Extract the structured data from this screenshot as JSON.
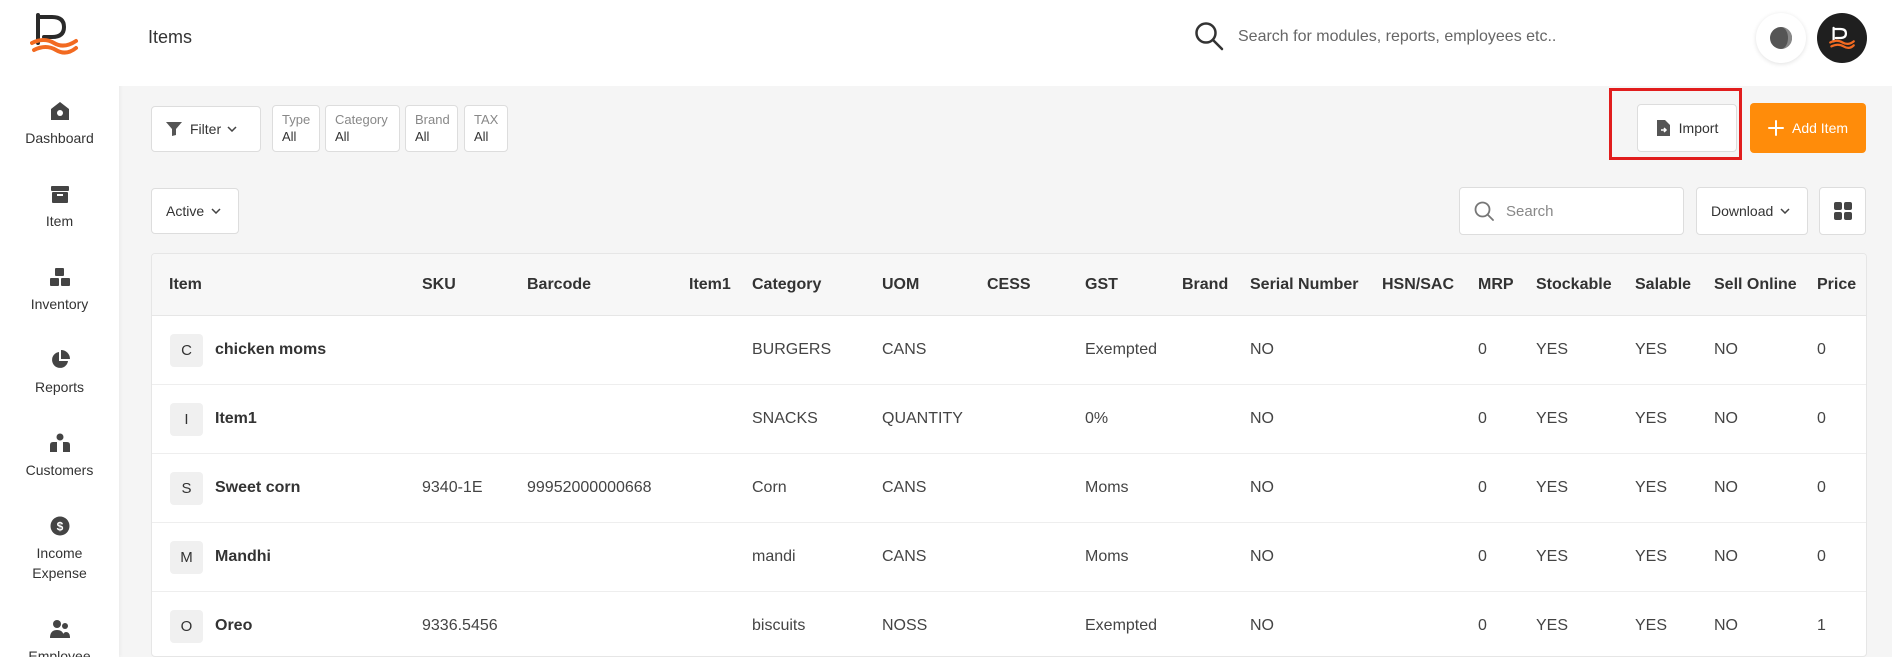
{
  "header": {
    "title": "Items",
    "search_placeholder": "Search for modules, reports, employees etc.."
  },
  "sidebar": {
    "items": [
      {
        "label": "Dashboard",
        "icon": "home-icon"
      },
      {
        "label": "Item",
        "icon": "box-icon"
      },
      {
        "label": "Inventory",
        "icon": "boxes-icon"
      },
      {
        "label": "Reports",
        "icon": "pie-chart-icon"
      },
      {
        "label": "Customers",
        "icon": "users-icon"
      },
      {
        "label": "Income\nExpense",
        "icon": "dollar-icon"
      },
      {
        "label": "Employee",
        "icon": "employee-icon"
      }
    ]
  },
  "toolbar": {
    "filter_label": "Filter",
    "chips": [
      {
        "label": "Type",
        "value": "All"
      },
      {
        "label": "Category",
        "value": "All"
      },
      {
        "label": "Brand",
        "value": "All"
      },
      {
        "label": "TAX",
        "value": "All"
      }
    ],
    "import_label": "Import",
    "add_label": "Add Item"
  },
  "list_controls": {
    "status_value": "Active",
    "search_placeholder": "Search",
    "download_label": "Download"
  },
  "table": {
    "columns": [
      "Item",
      "SKU",
      "Barcode",
      "Item1",
      "Category",
      "UOM",
      "CESS",
      "GST",
      "Brand",
      "Serial Number",
      "HSN/SAC",
      "MRP",
      "Stockable",
      "Salable",
      "Sell Online",
      "Price"
    ],
    "rows": [
      {
        "initial": "C",
        "item": "chicken moms",
        "sku": "",
        "barcode": "",
        "item1": "",
        "category": "BURGERS",
        "uom": "CANS",
        "cess": "",
        "gst": "Exempted",
        "brand": "",
        "serial": "NO",
        "hsn": "",
        "mrp": "0",
        "stockable": "YES",
        "salable": "YES",
        "online": "NO",
        "price": "0"
      },
      {
        "initial": "I",
        "item": "Item1",
        "sku": "",
        "barcode": "",
        "item1": "",
        "category": "SNACKS",
        "uom": "QUANTITY",
        "cess": "",
        "gst": "0%",
        "brand": "",
        "serial": "NO",
        "hsn": "",
        "mrp": "0",
        "stockable": "YES",
        "salable": "YES",
        "online": "NO",
        "price": "0"
      },
      {
        "initial": "S",
        "item": "Sweet corn",
        "sku": "9340-1E",
        "barcode": "99952000000668",
        "item1": "",
        "category": "Corn",
        "uom": "CANS",
        "cess": "",
        "gst": "Moms",
        "brand": "",
        "serial": "NO",
        "hsn": "",
        "mrp": "0",
        "stockable": "YES",
        "salable": "YES",
        "online": "NO",
        "price": "0"
      },
      {
        "initial": "M",
        "item": "Mandhi",
        "sku": "",
        "barcode": "",
        "item1": "",
        "category": "mandi",
        "uom": "CANS",
        "cess": "",
        "gst": "Moms",
        "brand": "",
        "serial": "NO",
        "hsn": "",
        "mrp": "0",
        "stockable": "YES",
        "salable": "YES",
        "online": "NO",
        "price": "0"
      },
      {
        "initial": "O",
        "item": "Oreo",
        "sku": "9336.5456",
        "barcode": "",
        "item1": "",
        "category": "biscuits",
        "uom": "NOSS",
        "cess": "",
        "gst": "Exempted",
        "brand": "",
        "serial": "NO",
        "hsn": "",
        "mrp": "0",
        "stockable": "YES",
        "salable": "YES",
        "online": "NO",
        "price": "1"
      }
    ]
  },
  "colors": {
    "accent": "#ff8c0a",
    "highlight": "#e11d1d",
    "logo_orange": "#f26a21"
  }
}
